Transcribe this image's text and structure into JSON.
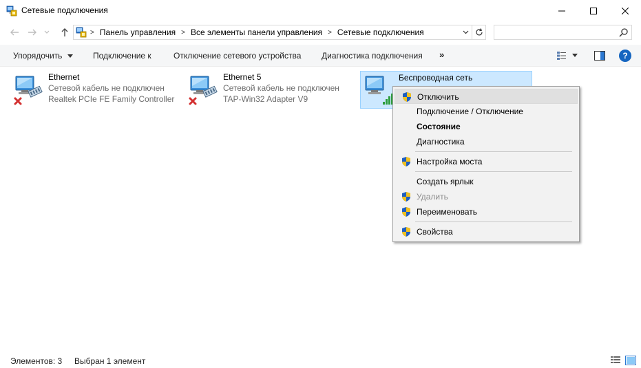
{
  "window": {
    "title": "Сетевые подключения",
    "controls": {
      "minimize": "–",
      "maximize": "☐",
      "close": "✕"
    }
  },
  "address": {
    "crumbs": [
      "Панель управления",
      "Все элементы панели управления",
      "Сетевые подключения"
    ],
    "separator": ">"
  },
  "search": {
    "placeholder": "",
    "value": ""
  },
  "toolbar": {
    "organize": "Упорядочить",
    "connect": "Подключение к",
    "disable_device": "Отключение сетевого устройства",
    "diagnose": "Диагностика подключения",
    "more": "»",
    "help": "?"
  },
  "connections": [
    {
      "name": "Ethernet",
      "status": "Сетевой кабель не подключен",
      "adapter": "Realtek PCIe FE Family Controller",
      "state": "disconnected"
    },
    {
      "name": "Ethernet 5",
      "status": "Сетевой кабель не подключен",
      "adapter": "TAP-Win32 Adapter V9",
      "state": "disconnected"
    },
    {
      "name": "Беспроводная сеть",
      "status": "",
      "adapter": "",
      "state": "connected",
      "selected": true
    }
  ],
  "context_menu": {
    "items": [
      {
        "label": "Отключить",
        "shield": true,
        "hover": true
      },
      {
        "label": "Подключение / Отключение",
        "shield": false
      },
      {
        "label": "Состояние",
        "shield": false,
        "bold": true
      },
      {
        "label": "Диагностика",
        "shield": false
      },
      {
        "label": "Настройка моста",
        "shield": true
      },
      {
        "label": "Создать ярлык",
        "shield": false
      },
      {
        "label": "Удалить",
        "shield": true,
        "disabled": true
      },
      {
        "label": "Переименовать",
        "shield": true
      },
      {
        "label": "Свойства",
        "shield": true
      }
    ]
  },
  "status": {
    "count": "Элементов: 3",
    "selected": "Выбран 1 элемент"
  },
  "colors": {
    "accent": "#0078d7",
    "selection_bg": "#cce8ff",
    "selection_border": "#99d1ff",
    "help_blue": "#1565c0",
    "error_red": "#d32f2f",
    "signal_green": "#2e9e3e"
  }
}
